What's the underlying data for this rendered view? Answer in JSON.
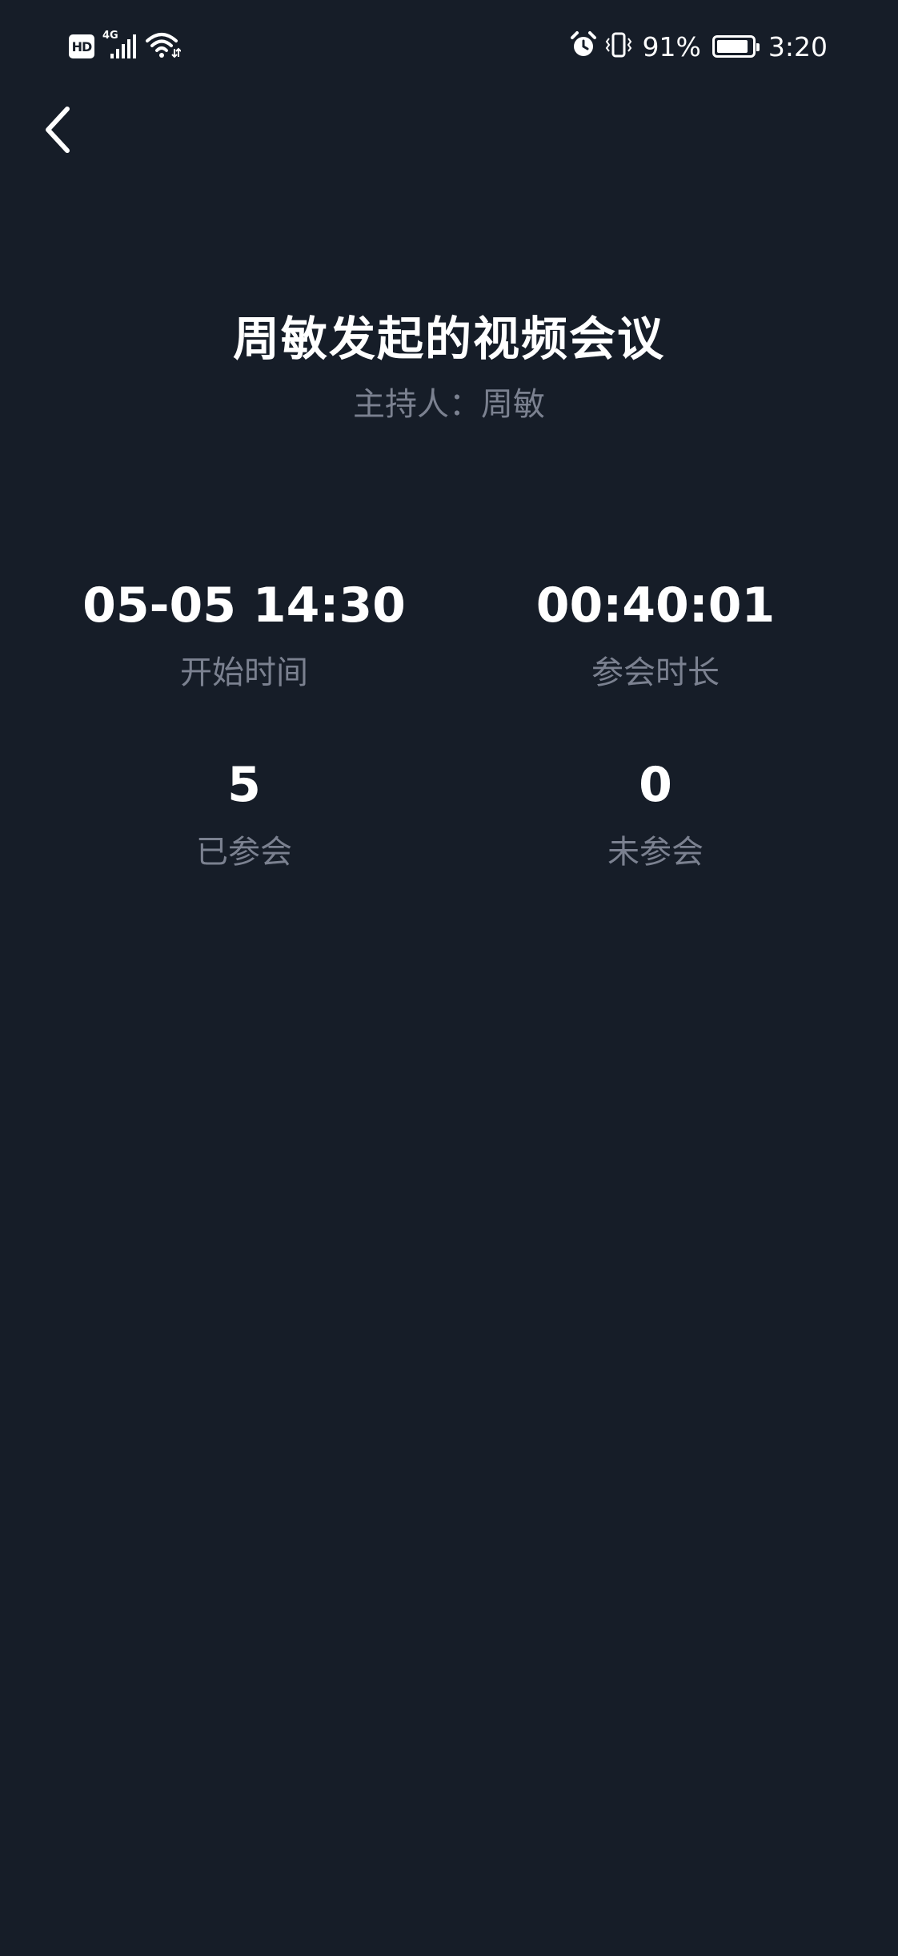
{
  "status_bar": {
    "hd_label": "HD",
    "network_label": "4G",
    "battery_percent_text": "91%",
    "battery_level": 0.91,
    "time": "3:20",
    "icons": [
      "hd-icon",
      "signal-icon",
      "wifi-icon",
      "alarm-icon",
      "vibrate-icon",
      "battery-icon"
    ]
  },
  "nav": {
    "back_icon": "chevron-left-icon"
  },
  "meeting": {
    "title": "周敏发起的视频会议",
    "host_line": "主持人：周敏"
  },
  "stats": {
    "start_time": {
      "value": "05-05 14:30",
      "label": "开始时间"
    },
    "duration": {
      "value": "00:40:01",
      "label": "参会时长"
    },
    "joined": {
      "value": "5",
      "label": "已参会"
    },
    "not_joined": {
      "value": "0",
      "label": "未参会"
    }
  },
  "colors": {
    "background": "#161d28",
    "primary_text": "#ffffff",
    "secondary_text": "#7b8190"
  }
}
